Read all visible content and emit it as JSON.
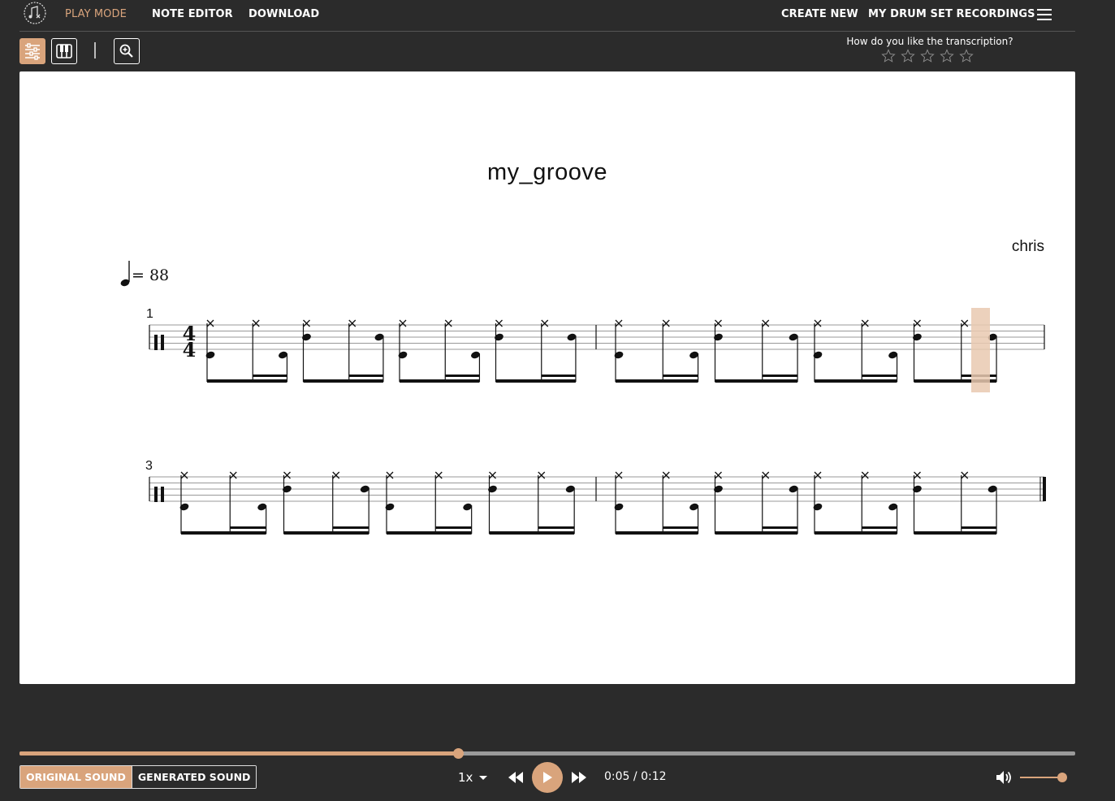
{
  "nav": {
    "play_mode": "PLAY MODE",
    "note_editor": "NOTE EDITOR",
    "download": "DOWNLOAD",
    "create_new": "CREATE NEW",
    "recordings": "MY DRUM SET RECORDINGS"
  },
  "toolbar": {
    "buttons": [
      "mixer-icon",
      "piano-icon",
      "zoom-in-icon"
    ]
  },
  "rating": {
    "question": "How do you like the transcription?",
    "stars": 5,
    "selected": 0
  },
  "score": {
    "title": "my_groove",
    "composer": "chris",
    "tempo": "= 88",
    "time_signature": "4/4",
    "systems": [
      {
        "measure_number": "1"
      },
      {
        "measure_number": "3"
      }
    ]
  },
  "player": {
    "original_sound": "ORIGINAL SOUND",
    "generated_sound": "GENERATED SOUND",
    "speed": "1x",
    "current_time": "0:05",
    "separator": "/",
    "total_time": "0:12",
    "progress": 0.415,
    "volume": 1.0
  },
  "colors": {
    "accent": "#d9a47c",
    "background": "#2b2b2b",
    "cursor": "#e9c9b0"
  }
}
